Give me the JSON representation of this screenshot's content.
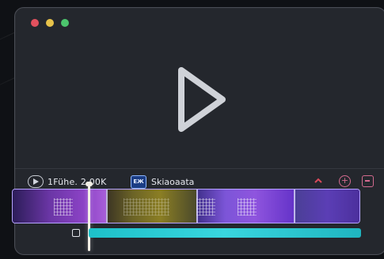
{
  "window": {
    "controls": [
      {
        "name": "close",
        "color": "#e2515e"
      },
      {
        "name": "minimize",
        "color": "#e8c34a"
      },
      {
        "name": "maximize",
        "color": "#4cc56d"
      }
    ]
  },
  "player": {
    "icon": "play-icon"
  },
  "toolbar": {
    "time_label": "1Fühe. 2.00K",
    "clip_icon_text": "ЕЖ",
    "clip_label": "Skiaoaata",
    "tools": [
      "marker-icon",
      "add-icon",
      "export-icon"
    ]
  },
  "timeline": {
    "accent": "#b6a3ff",
    "audio_color": "#39d6df",
    "segments": [
      {
        "name": "clip-1",
        "color": "#8f44c9"
      },
      {
        "name": "clip-2",
        "color": "#8b7e24"
      },
      {
        "name": "clip-3",
        "color": "#7c55d8"
      },
      {
        "name": "clip-4",
        "color": "#5b3eb5"
      }
    ]
  }
}
